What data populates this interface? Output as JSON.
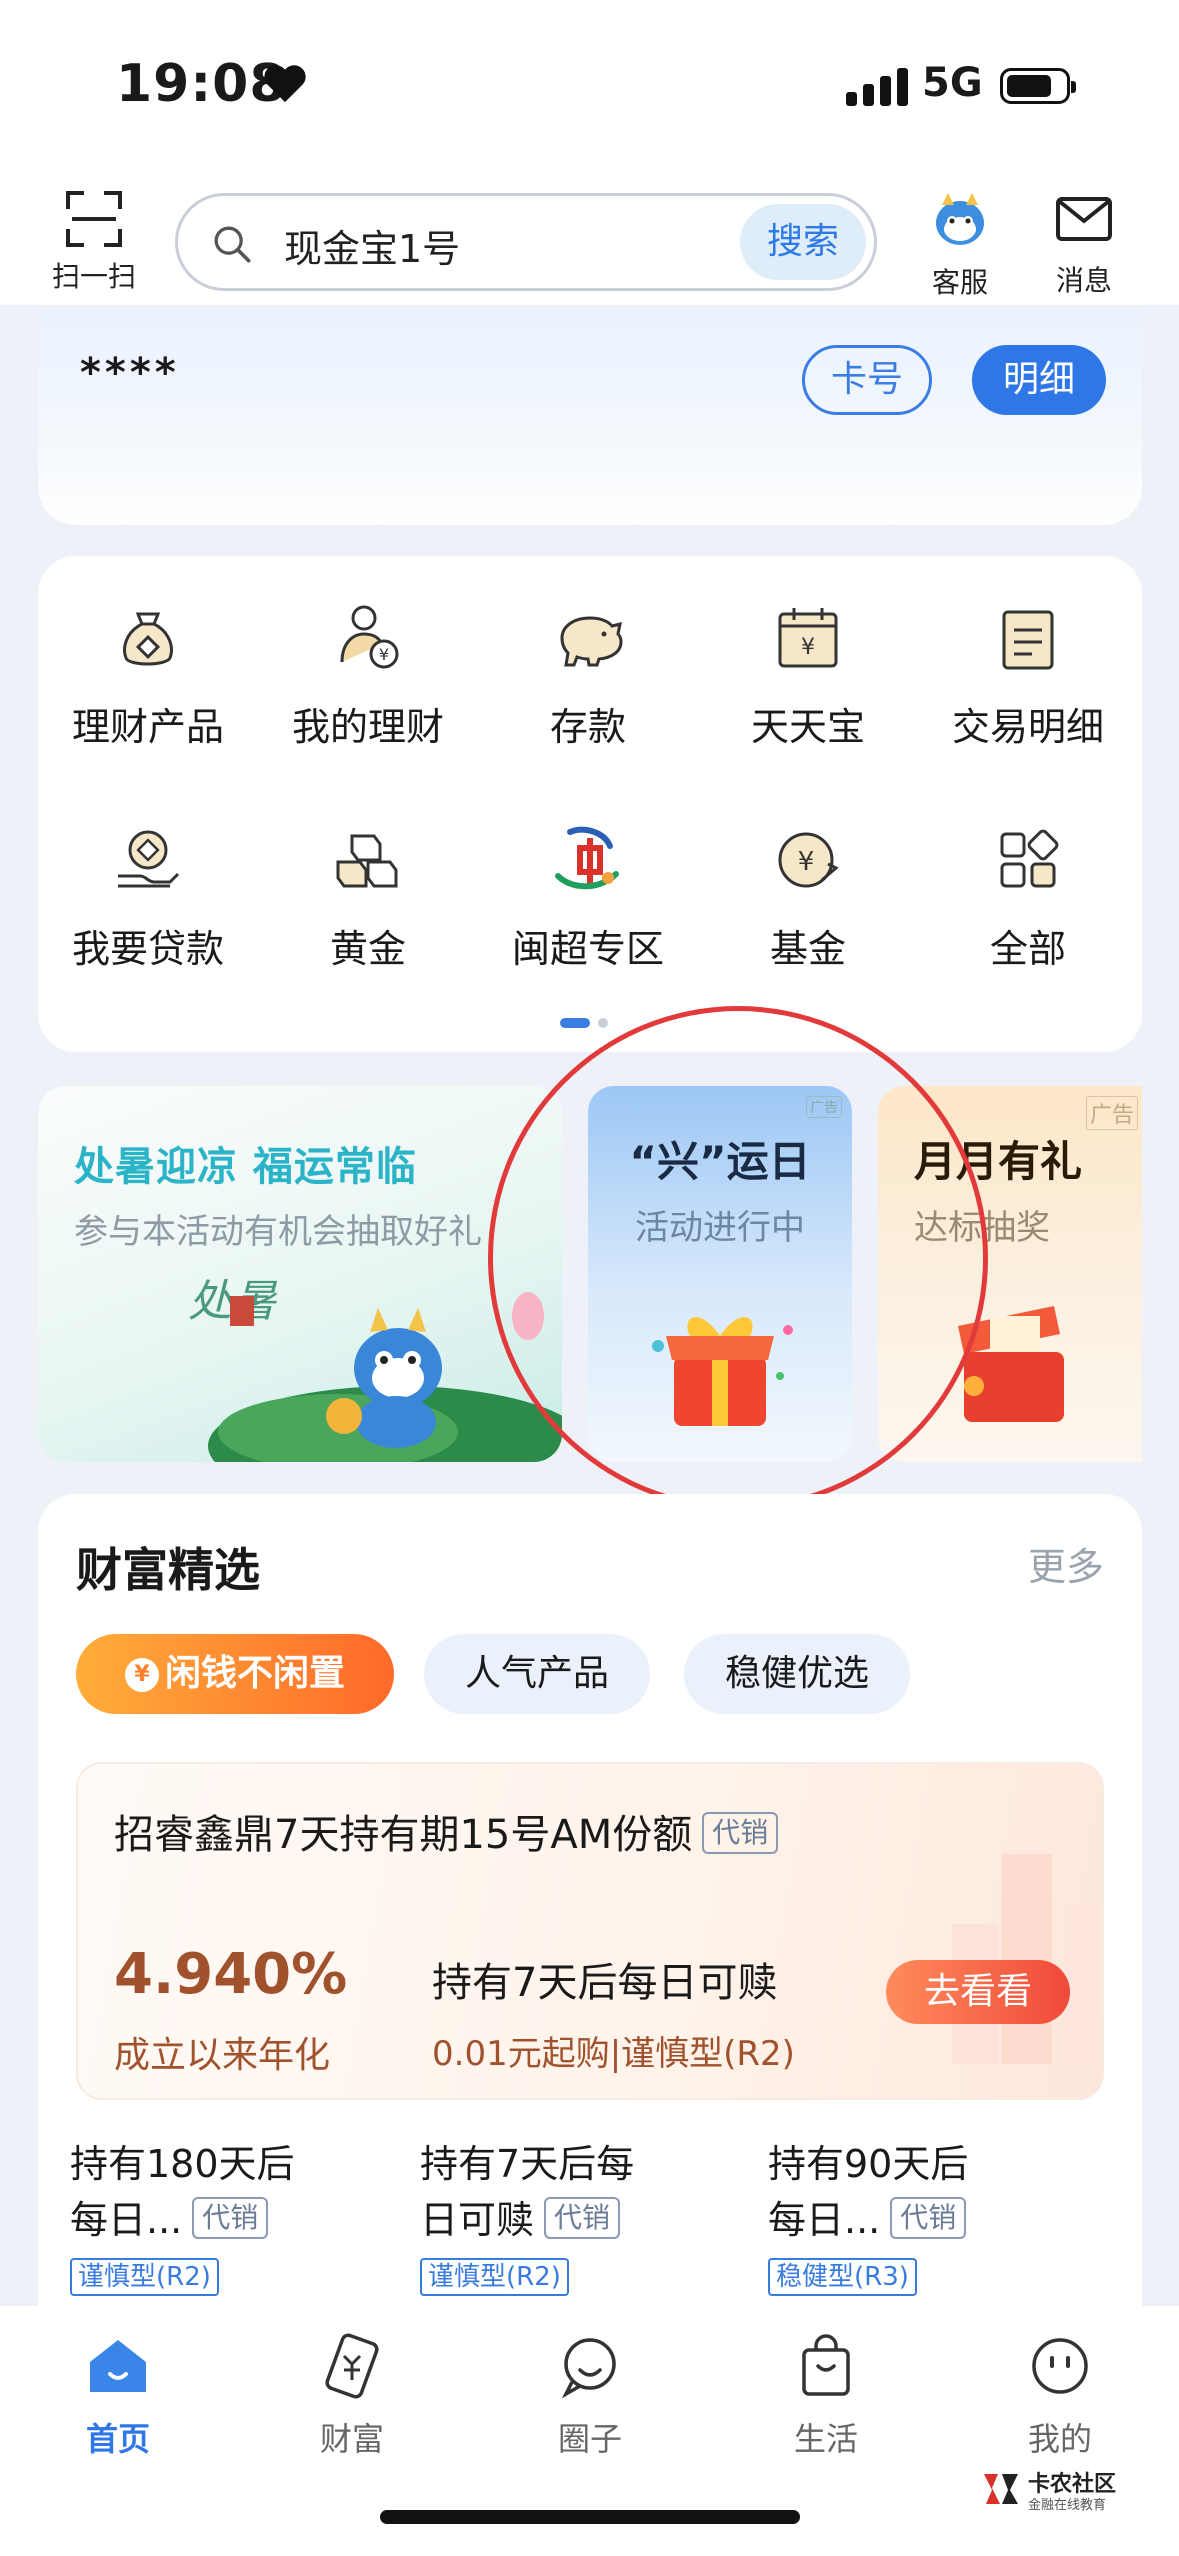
{
  "status_bar": {
    "time": "19:08",
    "network": "5G"
  },
  "top_bar": {
    "scan_label": "扫一扫",
    "search_text": "现金宝1号",
    "search_button": "搜索",
    "service_label": "客服",
    "message_label": "消息"
  },
  "account": {
    "masked_number": "****",
    "card_button": "卡号",
    "detail_button": "明细"
  },
  "menu": {
    "items": [
      {
        "label": "理财产品",
        "icon": "money-bag-icon"
      },
      {
        "label": "我的理财",
        "icon": "person-yen-icon"
      },
      {
        "label": "存款",
        "icon": "piggy-bank-icon"
      },
      {
        "label": "天天宝",
        "icon": "calendar-yen-icon"
      },
      {
        "label": "交易明细",
        "icon": "list-note-icon"
      },
      {
        "label": "我要贷款",
        "icon": "coin-hand-icon"
      },
      {
        "label": "黄金",
        "icon": "gold-bars-icon"
      },
      {
        "label": "闽超专区",
        "icon": "fujian-logo-icon"
      },
      {
        "label": "基金",
        "icon": "fund-yen-icon"
      },
      {
        "label": "全部",
        "icon": "grid-icon"
      }
    ],
    "page_indicator": {
      "pages": 2,
      "current": 1
    }
  },
  "banners": [
    {
      "title": "处暑迎凉 福运常临",
      "subtitle": "参与本活动有机会抽取好礼",
      "calligraphy": "处暑"
    },
    {
      "title": "“兴”运日",
      "subtitle": "活动进行中",
      "badge": "广告"
    },
    {
      "title": "月月有礼",
      "subtitle": "达标抽奖",
      "badge": "广告"
    }
  ],
  "wealth": {
    "title": "财富精选",
    "more": "更多",
    "tabs": [
      {
        "label": "闲钱不闲置",
        "active": true
      },
      {
        "label": "人气产品",
        "active": false
      },
      {
        "label": "稳健优选",
        "active": false
      }
    ],
    "featured": {
      "name": "招睿鑫鼎7天持有期15号AM份额",
      "tag": "代销",
      "rate": "4.940%",
      "rate_label": "成立以来年化",
      "redeem": "持有7天后每日可赎",
      "risk": "0.01元起购|谨慎型(R2)",
      "cta": "去看看"
    },
    "list": [
      {
        "line1": "持有180天后",
        "line2": "每日...",
        "tag": "代销",
        "risk": "谨慎型(R2)"
      },
      {
        "line1": "持有7天后每",
        "line2": "日可赎",
        "tag": "代销",
        "risk": "谨慎型(R2)"
      },
      {
        "line1": "持有90天后",
        "line2": "每日...",
        "tag": "代销",
        "risk": "稳健型(R3)"
      }
    ]
  },
  "bottom_nav": [
    {
      "label": "首页",
      "active": true
    },
    {
      "label": "财富",
      "active": false
    },
    {
      "label": "圈子",
      "active": false
    },
    {
      "label": "生活",
      "active": false
    },
    {
      "label": "我的",
      "active": false
    }
  ],
  "watermark": {
    "name": "卡农社区",
    "slogan": "金融在线教育"
  },
  "colors": {
    "brand_blue": "#2f77e6",
    "accent_orange": "#ff6a2a",
    "highlight_red": "#e23a3a"
  }
}
